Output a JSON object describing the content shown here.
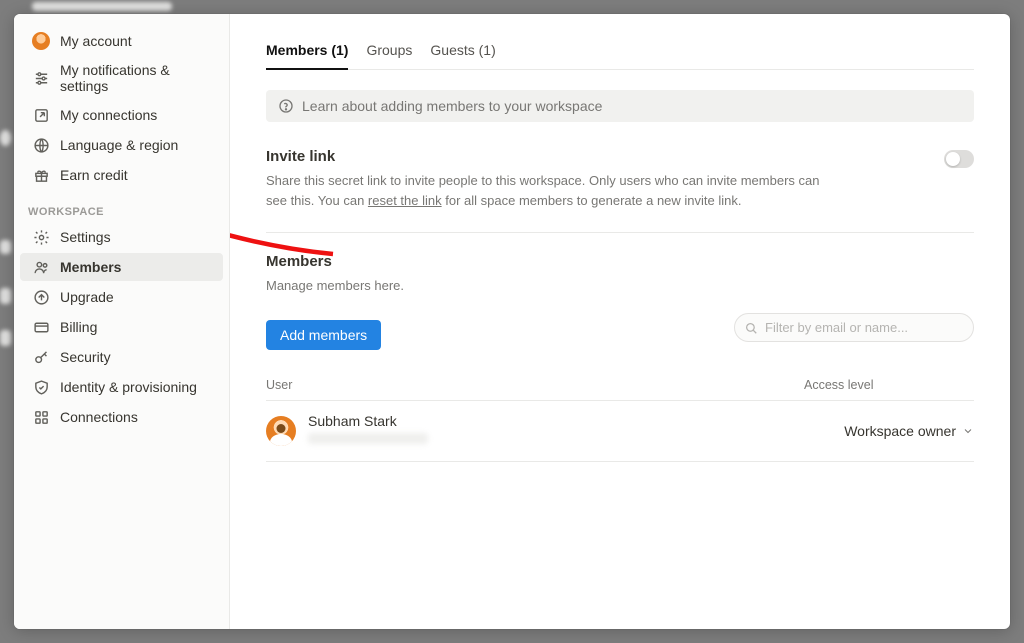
{
  "sidebar": {
    "account_section": [
      {
        "label": "My account",
        "key": "my-account",
        "icon": "avatar"
      },
      {
        "label": "My notifications & settings",
        "key": "notifications",
        "icon": "sliders"
      },
      {
        "label": "My connections",
        "key": "my-connections",
        "icon": "link-out"
      },
      {
        "label": "Language & region",
        "key": "language-region",
        "icon": "globe"
      },
      {
        "label": "Earn credit",
        "key": "earn-credit",
        "icon": "gift"
      }
    ],
    "workspace_heading": "WORKSPACE",
    "workspace_section": [
      {
        "label": "Settings",
        "key": "settings",
        "icon": "gear"
      },
      {
        "label": "Members",
        "key": "members",
        "icon": "people",
        "active": true
      },
      {
        "label": "Upgrade",
        "key": "upgrade",
        "icon": "arrow-up-circle"
      },
      {
        "label": "Billing",
        "key": "billing",
        "icon": "card"
      },
      {
        "label": "Security",
        "key": "security",
        "icon": "key"
      },
      {
        "label": "Identity & provisioning",
        "key": "identity",
        "icon": "shield"
      },
      {
        "label": "Connections",
        "key": "connections",
        "icon": "grid"
      }
    ]
  },
  "tabs": [
    {
      "label": "Members (1)",
      "key": "members",
      "active": true
    },
    {
      "label": "Groups",
      "key": "groups"
    },
    {
      "label": "Guests (1)",
      "key": "guests"
    }
  ],
  "banner": {
    "text": "Learn about adding members to your workspace"
  },
  "invite": {
    "title": "Invite link",
    "desc_prefix": "Share this secret link to invite people to this workspace. Only users who can invite members can see this. You can ",
    "link_text": "reset the link",
    "desc_suffix": " for all space members to generate a new invite link.",
    "toggle_on": false
  },
  "members_section": {
    "title": "Members",
    "desc": "Manage members here.",
    "add_button": "Add members",
    "search_placeholder": "Filter by email or name...",
    "columns": {
      "user": "User",
      "access": "Access level"
    },
    "rows": [
      {
        "name": "Subham Stark",
        "access": "Workspace owner"
      }
    ]
  }
}
